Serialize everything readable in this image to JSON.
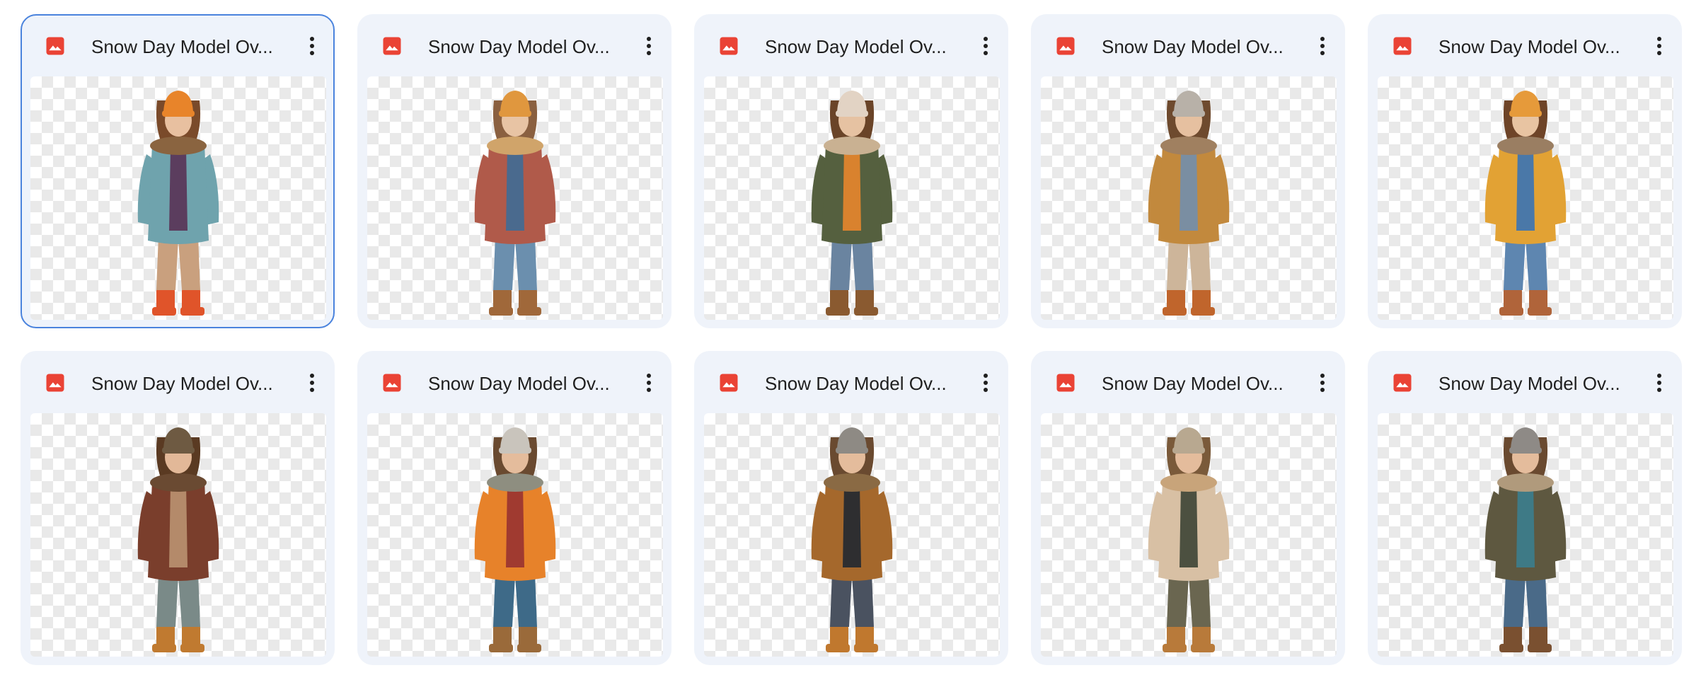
{
  "files": [
    {
      "title": "Snow Day Model Ov...",
      "icon": "image-file-icon",
      "selected": true,
      "colors": {
        "hat": "#e8842a",
        "coat": "#6fa3ad",
        "inner": "#5b3d5e",
        "pants": "#c9a07e",
        "boots": "#e0542a",
        "hair": "#7a4a2a",
        "skin": "#e8c0a0",
        "fur": "#8a6440"
      }
    },
    {
      "title": "Snow Day Model Ov...",
      "icon": "image-file-icon",
      "selected": false,
      "colors": {
        "hat": "#e0973e",
        "coat": "#b05a4a",
        "inner": "#4a6a8e",
        "pants": "#6b8fae",
        "boots": "#a0683a",
        "hair": "#8a6040",
        "skin": "#e8c4a4",
        "fur": "#d0a46a"
      }
    },
    {
      "title": "Snow Day Model Ov...",
      "icon": "image-file-icon",
      "selected": false,
      "colors": {
        "hat": "#e2d3c4",
        "coat": "#55603f",
        "inner": "#d9822e",
        "pants": "#6a84a0",
        "boots": "#8a5a30",
        "hair": "#6a4428",
        "skin": "#e6c2a2",
        "fur": "#c9b192"
      }
    },
    {
      "title": "Snow Day Model Ov...",
      "icon": "image-file-icon",
      "selected": false,
      "colors": {
        "hat": "#b8b1a8",
        "coat": "#c2893d",
        "inner": "#7a8ea2",
        "pants": "#cdb59a",
        "boots": "#c0652c",
        "hair": "#6e4a2e",
        "skin": "#e6c0a0",
        "fur": "#a08060"
      }
    },
    {
      "title": "Snow Day Model Ov...",
      "icon": "image-file-icon",
      "selected": false,
      "colors": {
        "hat": "#e69a3a",
        "coat": "#e2a234",
        "inner": "#4a78a8",
        "pants": "#5e86b0",
        "boots": "#b0643a",
        "hair": "#6e4428",
        "skin": "#e8c4a2",
        "fur": "#9a7e62"
      }
    },
    {
      "title": "Snow Day Model Ov...",
      "icon": "image-file-icon",
      "selected": false,
      "colors": {
        "hat": "#6e5a42",
        "coat": "#7a3e2c",
        "inner": "#b48a6a",
        "pants": "#7a8a88",
        "boots": "#c07a30",
        "hair": "#5a3a22",
        "skin": "#e2b898",
        "fur": "#6a4a32"
      }
    },
    {
      "title": "Snow Day Model Ov...",
      "icon": "image-file-icon",
      "selected": false,
      "colors": {
        "hat": "#c9c4bc",
        "coat": "#e7822a",
        "inner": "#a03a30",
        "pants": "#3e6a88",
        "boots": "#9a6a3a",
        "hair": "#6a4a30",
        "skin": "#e4bc9c",
        "fur": "#8e8e80"
      }
    },
    {
      "title": "Snow Day Model Ov...",
      "icon": "image-file-icon",
      "selected": false,
      "colors": {
        "hat": "#8e8a84",
        "coat": "#a5682c",
        "inner": "#2e2e30",
        "pants": "#4a5260",
        "boots": "#c0782e",
        "hair": "#6a4a30",
        "skin": "#e4bc9c",
        "fur": "#8a6a44"
      }
    },
    {
      "title": "Snow Day Model Ov...",
      "icon": "image-file-icon",
      "selected": false,
      "colors": {
        "hat": "#b8a890",
        "coat": "#d8c0a4",
        "inner": "#4c5040",
        "pants": "#6a6650",
        "boots": "#b87a3a",
        "hair": "#7a5a3a",
        "skin": "#e4bc9c",
        "fur": "#c8a47a"
      }
    },
    {
      "title": "Snow Day Model Ov...",
      "icon": "image-file-icon",
      "selected": false,
      "colors": {
        "hat": "#8e8a86",
        "coat": "#5e5840",
        "inner": "#3e7a86",
        "pants": "#4a6a88",
        "boots": "#7a5030",
        "hair": "#6a4a30",
        "skin": "#e4bc9c",
        "fur": "#b09a7c"
      }
    }
  ],
  "colors": {
    "card_bg": "#eff3fa",
    "selected_border": "#4a83dd",
    "image_icon": "#ea4335",
    "title_text": "#1f1f1f",
    "more_icon": "#1f1f1f"
  }
}
